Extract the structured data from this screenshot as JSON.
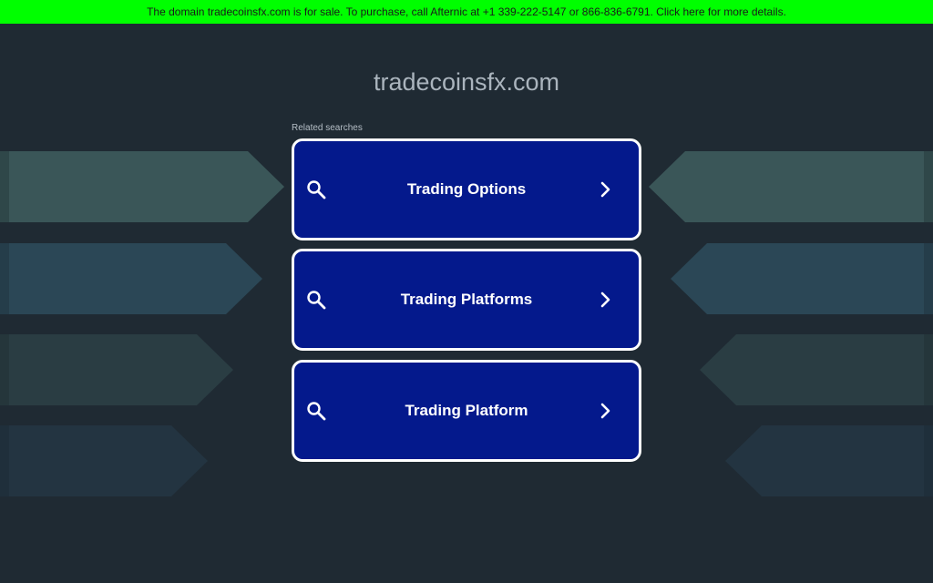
{
  "banner": {
    "text": "The domain tradecoinsfx.com is for sale. To purchase, call Afternic at +1 339-222-5147 or 866-836-6791. Click here for more details.",
    "color": "#00ff00"
  },
  "domain": {
    "title": "tradecoinsfx.com"
  },
  "related": {
    "label": "Related searches",
    "items": [
      {
        "label": "Trading Options",
        "icon": "search-icon",
        "arrow": "chevron-right-icon"
      },
      {
        "label": "Trading Platforms",
        "icon": "search-icon",
        "arrow": "chevron-right-icon"
      },
      {
        "label": "Trading Platform",
        "icon": "search-icon",
        "arrow": "chevron-right-icon"
      }
    ]
  },
  "colors": {
    "background": "#1f2a33",
    "button": "#04198c",
    "button_border": "#ffffff"
  }
}
